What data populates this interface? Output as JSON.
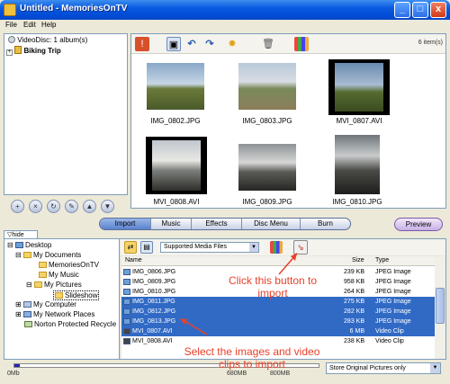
{
  "window": {
    "title": "Untitled - MemoriesOnTV",
    "buttons": [
      "_",
      "□",
      "x"
    ]
  },
  "menu": [
    "File",
    "Edit",
    "Help"
  ],
  "album_tree": {
    "root": "VideoDisc: 1 album(s)",
    "album": "Biking Trip"
  },
  "thumb_panel": {
    "items_count": "6 item(s)",
    "thumbnails": [
      {
        "label": "IMG_0802.JPG",
        "kind": "photo"
      },
      {
        "label": "IMG_0803.JPG",
        "kind": "photo"
      },
      {
        "label": "MVI_0807.AVI",
        "kind": "video"
      },
      {
        "label": "MVI_0808.AVI",
        "kind": "video"
      },
      {
        "label": "IMG_0809.JPG",
        "kind": "photo"
      },
      {
        "label": "IMG_0810.JPG",
        "kind": "photo"
      }
    ]
  },
  "tabs": [
    "Import",
    "Music",
    "Effects",
    "Disc Menu",
    "Burn"
  ],
  "active_tab": "Import",
  "preview_label": "Preview",
  "hide_label": "hide",
  "file_tree": {
    "items": [
      "Desktop",
      "My Documents",
      "MemoriesOnTV",
      "My Music",
      "My Pictures",
      "Slideshow",
      "My Computer",
      "My Network Places",
      "Norton Protected Recycle"
    ]
  },
  "file_list": {
    "filter": "Supported Media Files",
    "headers": {
      "name": "Name",
      "size": "Size",
      "type": "Type"
    },
    "rows": [
      {
        "name": "IMG_0806.JPG",
        "size": "239 KB",
        "type": "JPEG Image",
        "selected": false
      },
      {
        "name": "IMG_0809.JPG",
        "size": "958 KB",
        "type": "JPEG Image",
        "selected": false
      },
      {
        "name": "IMG_0810.JPG",
        "size": "264 KB",
        "type": "JPEG Image",
        "selected": false
      },
      {
        "name": "IMG_0811.JPG",
        "size": "275 KB",
        "type": "JPEG Image",
        "selected": true
      },
      {
        "name": "IMG_0812.JPG",
        "size": "282 KB",
        "type": "JPEG Image",
        "selected": true
      },
      {
        "name": "IMG_0813.JPG",
        "size": "283 KB",
        "type": "JPEG Image",
        "selected": true
      },
      {
        "name": "MVI_0807.AVI",
        "size": "6 MB",
        "type": "Video Clip",
        "selected": true
      },
      {
        "name": "MVI_0808.AVI",
        "size": "238 KB",
        "type": "Video Clip",
        "selected": false
      }
    ]
  },
  "capacity": {
    "labels": [
      "0Mb",
      "680MB",
      "800MB"
    ]
  },
  "store_option": "Store Original Pictures only",
  "annotations": {
    "click_button": "Click this button to import",
    "select_items": "Select the images and video clips to import"
  },
  "colors": {
    "accent": "#316ac5",
    "annotation": "#e8412a"
  }
}
